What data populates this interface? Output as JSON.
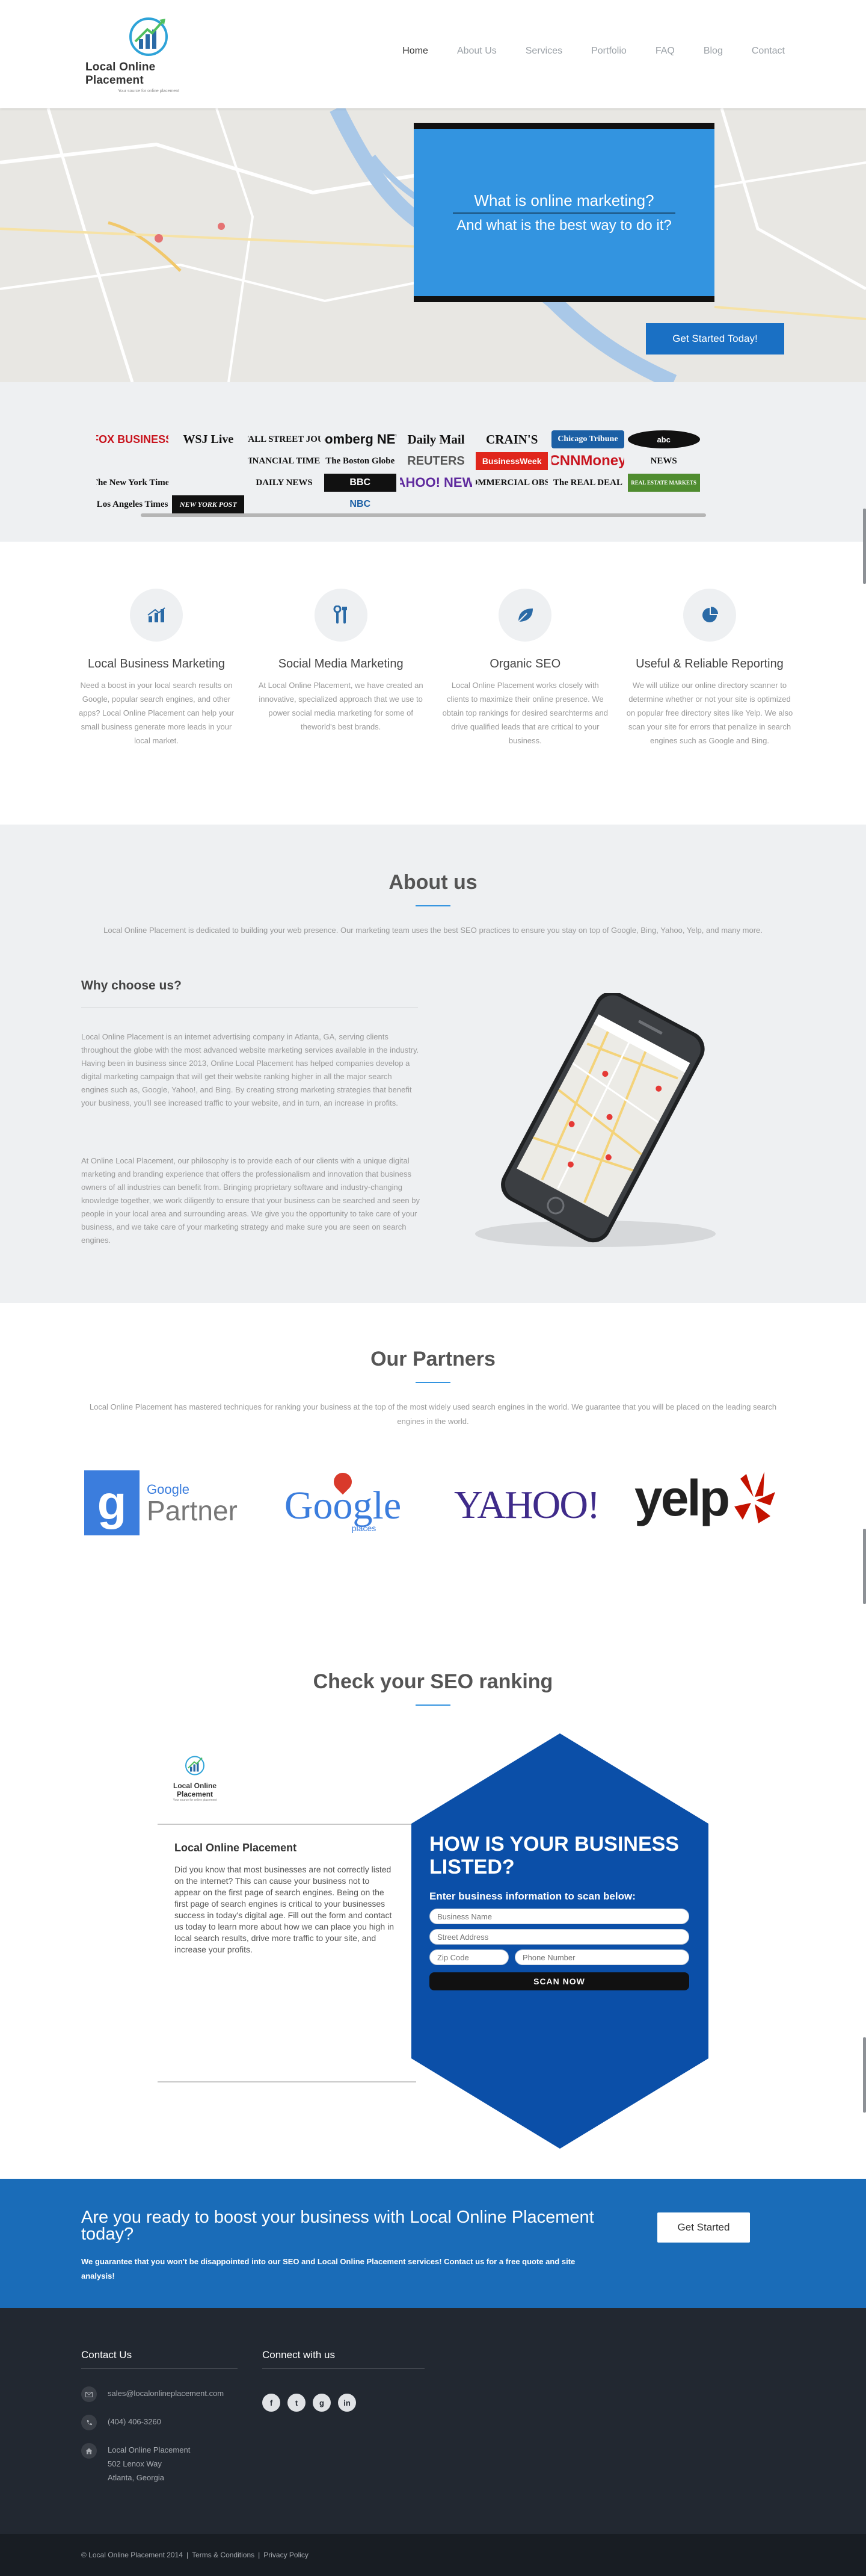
{
  "brand": {
    "name": "Local Online Placement",
    "tagline": "Your source for online placement"
  },
  "nav": {
    "items": [
      "Home",
      "About Us",
      "Services",
      "Portfolio",
      "FAQ",
      "Blog",
      "Contact"
    ]
  },
  "hero": {
    "line1": "What is online marketing?",
    "line2": "And what is the best way to do it?",
    "button": "Get Started Today!"
  },
  "press": {
    "logos": [
      "FOX BUSINESS",
      "WSJ Live",
      "THE WALL STREET JOURNAL",
      "Bloomberg NEWS",
      "Daily Mail",
      "CRAIN'S",
      "Chicago Tribune",
      "abc",
      "",
      "",
      "",
      "FINANCIAL TIMES",
      "The Boston Globe",
      "REUTERS",
      "BusinessWeek",
      "CNNMoney",
      "NEWS",
      "",
      "The New York Times",
      "",
      "DAILY NEWS",
      "BBC",
      "YAHOO! NEWS",
      "THE COMMERCIAL OBSERVER",
      "The REAL DEAL",
      "REAL ESTATE MARKETS",
      "",
      "Los Angeles Times",
      "NEW YORK POST",
      "",
      "NBC",
      "",
      "",
      "",
      "",
      ""
    ]
  },
  "services": [
    {
      "title": "Local Business Marketing",
      "icon": "bar-chart-icon",
      "text": "Need a boost in your local search results on Google, popular search engines, and other apps? Local Online Placement can help your small business generate more leads in your local market."
    },
    {
      "title": "Social Media Marketing",
      "icon": "tools-icon",
      "text": "At Local Online Placement, we have created an innovative, specialized approach that we use to power social media marketing for some of theworld's best brands."
    },
    {
      "title": "Organic SEO",
      "icon": "leaf-icon",
      "text": "Local Online Placement works closely with clients to maximize their online presence. We obtain top rankings for desired searchterms and drive qualified leads that are critical to your business."
    },
    {
      "title": "Useful & Reliable Reporting",
      "icon": "pie-chart-icon",
      "text": "We will utilize our online directory scanner to determine whether or not your site is optimized on popular free directory sites like Yelp. We also scan your site for errors that penalize in search engines such as Google and Bing."
    }
  ],
  "about": {
    "title": "About us",
    "lead": "Local Online Placement is dedicated to building your web presence. Our marketing team uses the best SEO practices to ensure you stay on top of Google, Bing, Yahoo, Yelp, and many more.",
    "why_title": "Why choose us?",
    "p1": "Local Online Placement is an internet advertising company in Atlanta, GA, serving clients throughout the globe with the most advanced website marketing services available in the industry. Having been in business since 2013, Online Local Placement has helped companies develop a digital marketing campaign that will get their website ranking higher in all the major search engines such as, Google, Yahoo!, and Bing. By creating strong marketing strategies that benefit your business, you'll see increased traffic to your website, and in turn, an increase in profits.",
    "p2": "At Online Local Placement, our philosophy is to provide each of our clients with a unique digital marketing and branding experience that offers the professionalism and innovation that business owners of all industries can benefit from. Bringing proprietary software and industry-changing knowledge together, we work diligently to ensure that your business can be searched and seen by people in your local area and surrounding areas. We give you the opportunity to take care of your business, and we take care of your marketing strategy and make sure you are seen on search engines."
  },
  "partners": {
    "title": "Our Partners",
    "lead": "Local Online Placement has mastered techniques for ranking your business at the top of the most widely used search engines in the world. We guarantee that you will be placed on the leading search engines in the world.",
    "google_partner_small": "Google",
    "google_partner_big": "Partner",
    "google_places": "Google",
    "google_places_sub": "places",
    "yahoo": "YAHOO!",
    "yelp": "yelp"
  },
  "seo": {
    "title": "Check your SEO ranking",
    "company": "Local Online Placement",
    "description": "Did you know that most businesses are not correctly listed on the internet? This can cause your business not to appear on the first page of search engines. Being on the first page of search engines is critical to your businesses success in today's digital age. Fill out the form and contact us today to learn more about how we can place you high in local search results, drive more traffic to your site, and increase your profits.",
    "form_title": "HOW IS YOUR BUSINESS LISTED?",
    "form_sub": "Enter business information to scan below:",
    "ph_name": "Business Name",
    "ph_address": "Street Address",
    "ph_zip": "Zip Code",
    "ph_phone": "Phone Number",
    "scan": "SCAN NOW"
  },
  "cta": {
    "title": "Are you ready to boost your business with Local Online Placement today?",
    "text": "We guarantee that you won't be disappointed into our SEO and Local Online Placement services! Contact us for a free quote and site analysis!",
    "button": "Get Started"
  },
  "footer": {
    "contact_title": "Contact Us",
    "connect_title": "Connect with us",
    "email": "sales@localonlineplacement.com",
    "phone": "(404) 406-3260",
    "addr1": "Local Online Placement",
    "addr2": "502 Lenox Way",
    "addr3": "Atlanta, Georgia",
    "social": [
      "f",
      "t",
      "g",
      "in"
    ]
  },
  "bottom": {
    "copyright": "© Local Online Placement 2014",
    "terms": "Terms & Conditions",
    "privacy": "Privacy Policy",
    "sep": "|"
  },
  "colors": {
    "accent": "#3394e0",
    "cta": "#1a6cb8",
    "footer": "#222831"
  }
}
